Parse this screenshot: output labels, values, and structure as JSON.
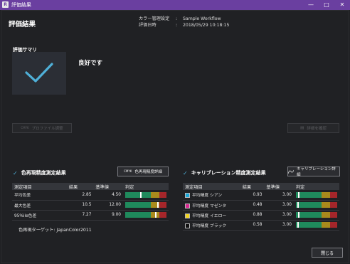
{
  "window": {
    "title": "評価結果",
    "app_icon": "R"
  },
  "header": {
    "page_title": "評価結果",
    "color_mgmt_key": "カラー管理設定",
    "color_mgmt_value": "Sample Workflow",
    "eval_date_key": "評価日時",
    "eval_date_value": "2018/05/29 10:18:15",
    "separator": ":"
  },
  "summary": {
    "label": "評価サマリ",
    "message": "良好です",
    "accent_color": "#4fb0d8"
  },
  "buttons": {
    "profile_adjust": "プロファイル調整",
    "profile_icon": "CMYK",
    "confirm_details": "詳細を確認",
    "color_detail": "色再現精度詳細",
    "color_detail_icon": "CMYK",
    "calib_detail": "キャリブレーション詳細",
    "close": "閉じる"
  },
  "color_section": {
    "title": "色再現精度測定結果",
    "headers": [
      "測定項目",
      "結果",
      "基準値",
      "判定"
    ],
    "rows": [
      {
        "item": "平均色差",
        "result": "2.85",
        "standard": "4.50",
        "level": 0.36
      },
      {
        "item": "最大色差",
        "result": "10.5",
        "standard": "12.00",
        "level": 0.77
      },
      {
        "item": "95%ile色差",
        "result": "7.27",
        "standard": "9.00",
        "level": 0.73
      }
    ],
    "target_label": "色再現ターゲット: JapanColor2011"
  },
  "calib_section": {
    "title": "キャリブレーション精度測定結果",
    "headers": [
      "測定項目",
      "結果",
      "基準値",
      "判定"
    ],
    "rows": [
      {
        "item": "平均精度 シアン",
        "result": "0.93",
        "standard": "3.00",
        "swatch": "#1aa7d8",
        "level": 0.05
      },
      {
        "item": "平均精度 マゼンタ",
        "result": "0.48",
        "standard": "3.00",
        "swatch": "#d6278f",
        "level": 0.03
      },
      {
        "item": "平均精度 イエロー",
        "result": "0.88",
        "standard": "3.00",
        "swatch": "#f0d21c",
        "level": 0.05
      },
      {
        "item": "平均精度 ブラック",
        "result": "0.58",
        "standard": "3.00",
        "swatch": "#111111",
        "level": 0.04
      }
    ]
  },
  "colors": {
    "good": "#1f8a5c",
    "warn": "#a98a1c",
    "bad": "#a5262a",
    "titlebar": "#6a3fa0"
  }
}
